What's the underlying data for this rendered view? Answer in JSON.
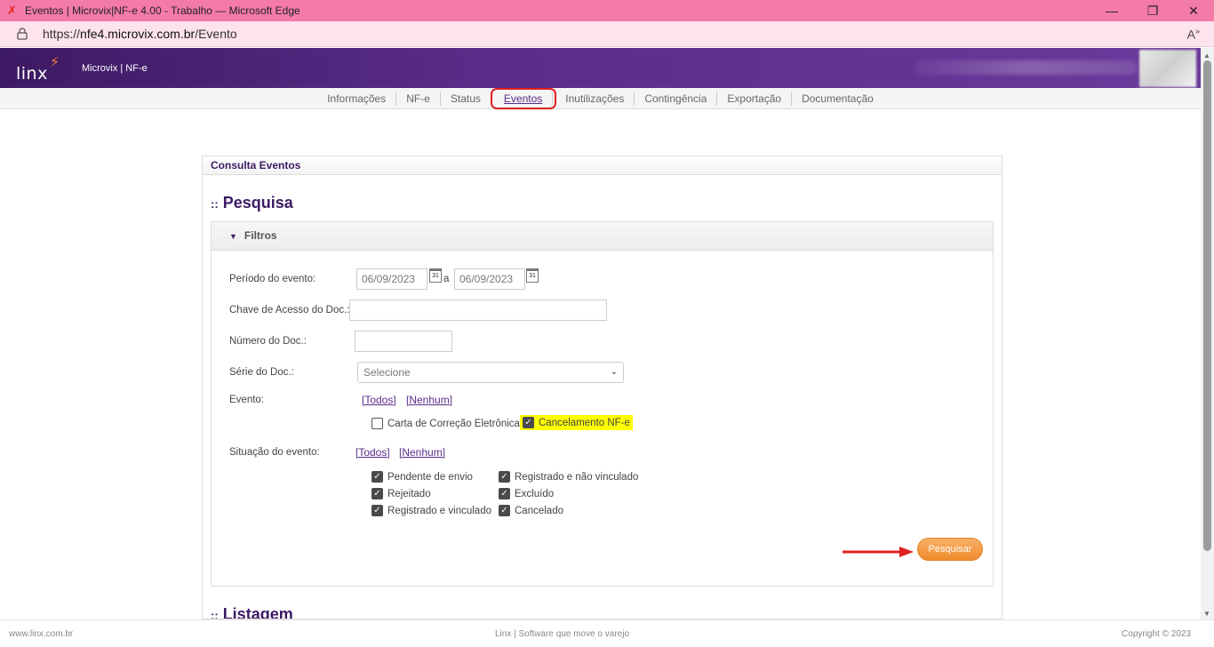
{
  "browser": {
    "title": "Eventos | Microvix|NF-e 4.00 - Trabalho — Microsoft Edge",
    "url_prefix": "https://",
    "url_host": "nfe4.microvix.com.br",
    "url_path": "/Evento",
    "minimize": "—",
    "restore": "❐",
    "close": "✕",
    "read_aloud": "A̅́"
  },
  "header": {
    "logo_text": "Linx",
    "product": "Microvix | NF-e"
  },
  "nav": {
    "items": [
      "Informações",
      "NF-e",
      "Status",
      "Eventos",
      "Inutilizações",
      "Contingência",
      "Exportação",
      "Documentação"
    ],
    "active": "Eventos"
  },
  "panel": {
    "title": "Consulta Eventos",
    "search_prefix": "::",
    "search_title": "Pesquisa",
    "filters_title": "Filtros",
    "listing_prefix": "::",
    "listing_title": "Listagem"
  },
  "form": {
    "period_label": "Período do evento:",
    "date_from": "06/09/2023",
    "date_sep": "a",
    "date_to": "06/09/2023",
    "cal_text": "31",
    "access_key_label": "Chave de Acesso do Doc.:",
    "access_key_value": "",
    "doc_number_label": "Número do Doc.:",
    "doc_number_value": "",
    "series_label": "Série do Doc.:",
    "series_selected": "Selecione",
    "event_label": "Evento:",
    "all_link": "[Todos]",
    "none_link": "[Nenhum]",
    "event_options": [
      {
        "label": "Carta de Correção Eletrônica",
        "checked": false
      },
      {
        "label": "Cancelamento NF-e",
        "checked": true
      }
    ],
    "status_label": "Situação do evento:",
    "status_options": [
      {
        "label": "Pendente de envio",
        "checked": true
      },
      {
        "label": "Registrado e não vinculado",
        "checked": true
      },
      {
        "label": "Rejeitado",
        "checked": true
      },
      {
        "label": "Excluído",
        "checked": true
      },
      {
        "label": "Registrado e vinculado",
        "checked": true
      },
      {
        "label": "Cancelado",
        "checked": true
      }
    ],
    "search_button": "Pesquisar"
  },
  "footer": {
    "left": "www.linx.com.br",
    "center": "Linx | Software que move o varejo",
    "right": "Copyright © 2023"
  },
  "colors": {
    "brand_purple": "#5a2c89",
    "accent_orange": "#f08c2d",
    "title_bar": "#f47aa8",
    "highlight": "#ffff00",
    "annotation_red": "#e02020"
  }
}
